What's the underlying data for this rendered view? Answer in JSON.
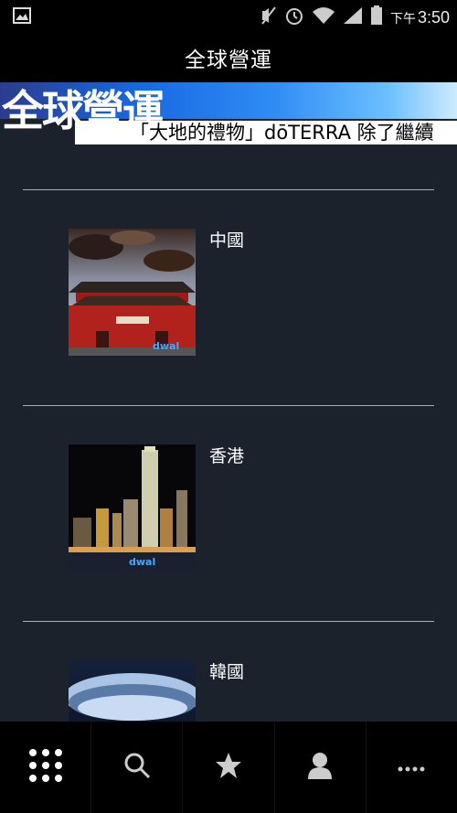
{
  "status_bar": {
    "time_prefix": "下午",
    "time": "3:50",
    "icons": [
      "image-icon",
      "mute-icon",
      "alarm-icon",
      "wifi-icon",
      "signal-icon",
      "battery-icon"
    ]
  },
  "title_bar": {
    "title": "全球營運"
  },
  "banner": {
    "title": "全球營運",
    "ticker": "「大地的禮物」dōTERRA 除了繼續"
  },
  "list": {
    "items": [
      {
        "label": "中國",
        "image": "forbidden-city-photo"
      },
      {
        "label": "香港",
        "image": "hong-kong-skyline-photo"
      },
      {
        "label": "韓國",
        "image": "dome-stadium-photo"
      }
    ],
    "watermark": "dwal"
  },
  "bottom_nav": {
    "items": [
      "grid-menu-icon",
      "search-icon",
      "star-icon",
      "user-icon",
      "more-icon"
    ]
  },
  "colors": {
    "background": "#1b222c",
    "bars": "#000000",
    "divider": "#a9adb4"
  }
}
